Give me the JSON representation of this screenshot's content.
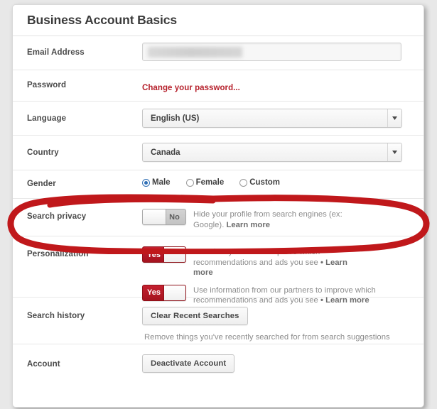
{
  "card": {
    "title": "Business Account Basics"
  },
  "colors": {
    "accent_red": "#b51f2a",
    "toggle_on": "#b5192a",
    "annotation_red": "#c0181b",
    "radio_blue": "#2f6fb5",
    "label_text": "#4a4a4a",
    "muted_text": "#8c8c8c"
  },
  "rows": {
    "email": {
      "label": "Email Address",
      "value": "",
      "placeholder": "",
      "redacted": true
    },
    "password": {
      "label": "Password",
      "link": "Change your password..."
    },
    "language": {
      "label": "Language",
      "selected": "English (US)",
      "arrow_icon": "chevron-down-icon"
    },
    "country": {
      "label": "Country",
      "selected": "Canada",
      "arrow_icon": "chevron-down-icon"
    },
    "gender": {
      "label": "Gender",
      "options": [
        {
          "label": "Male",
          "checked": true
        },
        {
          "label": "Female",
          "checked": false
        },
        {
          "label": "Custom",
          "checked": false
        }
      ]
    },
    "search_privacy": {
      "label": "Search privacy",
      "toggle_state": "No",
      "toggle_on": false,
      "description_plain": "Hide your profile from search engines (ex: Google). ",
      "description_link": "Learn more"
    },
    "personalization": {
      "label": "Personalization",
      "toggles": [
        {
          "state": "Yes",
          "on": true,
          "description_plain": "Use sites you visit to improve which recommendations and ads you see ",
          "description_link": "• Learn more"
        },
        {
          "state": "Yes",
          "on": true,
          "description_plain": "Use information from our partners to improve which recommendations and ads you see ",
          "description_link": "• Learn more"
        }
      ]
    },
    "search_history": {
      "label": "Search history",
      "button": "Clear Recent Searches",
      "note": "Remove things you've recently searched for from search suggestions"
    },
    "account": {
      "label": "Account",
      "button": "Deactivate Account"
    }
  },
  "annotation": {
    "shape": "hand-drawn-ellipse",
    "targets": "search-privacy-row"
  }
}
